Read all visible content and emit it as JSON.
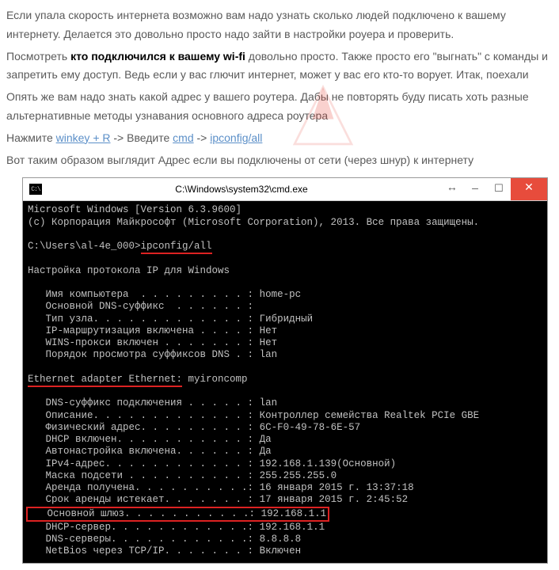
{
  "para1": "Если упала скорость интернета возможно вам надо узнать сколько людей подключено к вашему интернету. Делается это довольно просто надо зайти в настройки роуера и проверить.",
  "para2_a": "Посмотреть ",
  "para2_bold": "кто подключился к вашему wi-fi",
  "para2_b": " довольно просто. Также просто его \"выгнать\" с команды и запретить ему доступ. Ведь если у вас глючит интернет, может у вас его кто-то ворует. Итак, поехали",
  "para3": "Опять же вам надо знать какой адрес у вашего роутера. Дабы не повторять буду писать хоть разные альтернативные методы узнавания основного адреса роутера",
  "para4_a": "Нажмите ",
  "para4_link1": "winkey + R",
  "para4_arrow1": " -> ",
  "para4_b": "Введите ",
  "para4_link2": "cmd",
  "para4_arrow2": " -> ",
  "para4_link3": "ipconfig/all",
  "para5": "Вот таким образом выглядит Адрес если вы подключены от сети (через шнур) к интернету",
  "cmd": {
    "title": "C:\\Windows\\system32\\cmd.exe",
    "btn_expand": "↔",
    "btn_min": "—",
    "btn_max": "☐",
    "btn_close": "✕",
    "line1": "Microsoft Windows [Version 6.3.9600]",
    "line2": "(c) Корпорация Майкрософт (Microsoft Corporation), 2013. Все права защищены.",
    "prompt": "C:\\Users\\al-4e_000>",
    "typed": "ipconfig/all",
    "heading1": "Настройка протокола IP для Windows",
    "l_host_k": "   Имя компьютера  . . . . . . . . . : ",
    "l_host_v": "home-pc",
    "l_dns_k": "   Основной DNS-суффикс  . . . . . . :",
    "l_node_k": "   Тип узла. . . . . . . . . . . . . : ",
    "l_node_v": "Гибридный",
    "l_route_k": "   IP-маршрутизация включена . . . . : ",
    "l_route_v": "Нет",
    "l_wins_k": "   WINS-прокси включен . . . . . . . : ",
    "l_wins_v": "Нет",
    "l_order_k": "   Порядок просмотра суффиксов DNS . : ",
    "l_order_v": "lan",
    "eth_label": "Ethernet adapter Ethernet:",
    "eth_name": " myironcomp",
    "e_dns_k": "   DNS-суффикс подключения . . . . . : ",
    "e_dns_v": "lan",
    "e_desc_k": "   Описание. . . . . . . . . . . . . : ",
    "e_desc_v": "Контроллер семейства Realtek PCIe GBE",
    "e_mac_k": "   Физический адрес. . . . . . . . . : ",
    "e_mac_v": "6C-F0-49-78-6E-57",
    "e_dhcp_k": "   DHCP включен. . . . . . . . . . . : ",
    "e_dhcp_v": "Да",
    "e_auto_k": "   Автонастройка включена. . . . . . : ",
    "e_auto_v": "Да",
    "e_ip_k": "   IPv4-адрес. . . . . . . . . . . . : ",
    "e_ip_v": "192.168.1.139(Основной)",
    "e_mask_k": "   Маска подсети . . . . . . . . . . : ",
    "e_mask_v": "255.255.255.0",
    "e_lease_k": "   Аренда получена. . . . . . . . . .: ",
    "e_lease_v": "16 января 2015 г. 13:37:18",
    "e_exp_k": "   Срок аренды истекает. . . . . . . : ",
    "e_exp_v": "17 января 2015 г. 2:45:52",
    "e_gw_k": "   Основной шлюз. . . . . . . . . . .: ",
    "e_gw_v": "192.168.1.1",
    "e_dsrv_k": "   DHCP-сервер. . . . . . . . . . . .: ",
    "e_dsrv_v": "192.168.1.1",
    "e_dns2_k": "   DNS-серверы. . . . . . . . . . . .: ",
    "e_dns2_v": "8.8.8.8",
    "e_nb_k": "   NetBios через TCP/IP. . . . . . . : ",
    "e_nb_v": "Включен"
  }
}
